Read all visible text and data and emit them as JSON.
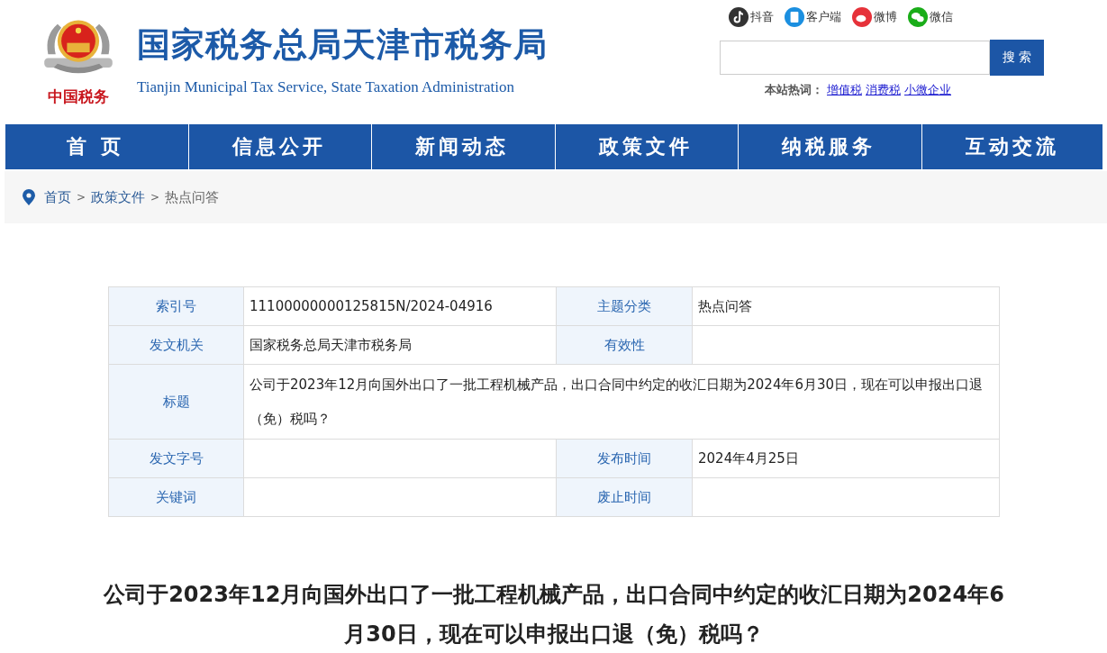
{
  "header": {
    "logo_caption": "中国税务",
    "title": "国家税务总局天津市税务局",
    "subtitle": "Tianjin Municipal Tax Service, State Taxation Administration"
  },
  "social_links": [
    {
      "kind": "tiktok",
      "label": "抖音"
    },
    {
      "kind": "app",
      "label": "客户端"
    },
    {
      "kind": "weibo",
      "label": "微博"
    },
    {
      "kind": "wechat",
      "label": "微信"
    }
  ],
  "search": {
    "button": "搜 索"
  },
  "hot_words": {
    "label": "本站热词：",
    "links": [
      "增值税",
      "消费税",
      "小微企业"
    ]
  },
  "nav": [
    {
      "label": "首 页",
      "selected": false
    },
    {
      "label": "信息公开",
      "selected": false
    },
    {
      "label": "新闻动态",
      "selected": false
    },
    {
      "label": "政策文件",
      "selected": false
    },
    {
      "label": "纳税服务",
      "selected": false
    },
    {
      "label": "互动交流",
      "selected": false
    }
  ],
  "breadcrumb": {
    "items": [
      "首页",
      "政策文件",
      "热点问答"
    ],
    "separator": ">"
  },
  "info_table": {
    "rows": [
      {
        "cells": [
          {
            "label": "索引号",
            "value": "11100000000125815N/2024-04916"
          },
          {
            "label": "主题分类",
            "value": "热点问答"
          }
        ]
      },
      {
        "cells": [
          {
            "label": "发文机关",
            "value": "国家税务总局天津市税务局"
          },
          {
            "label": "有效性"
          }
        ]
      },
      {
        "cells": [
          {
            "label": "标题",
            "value": "公司于2023年12月向国外出口了一批工程机械产品，出口合同中约定的收汇日期为2024年6月30日，现在可以申报出口退（免）税吗？"
          }
        ]
      },
      {
        "cells": [
          {
            "label": "发文字号"
          },
          {
            "label": "发布时间",
            "value": "2024年4月25日"
          }
        ]
      },
      {
        "cells": [
          {
            "label": "关键词"
          },
          {
            "label": "废止时间"
          }
        ]
      }
    ]
  },
  "article": {
    "title": "公司于2023年12月向国外出口了一批工程机械产品，出口合同中约定的收汇日期为2024年6月30日，现在可以申报出口退（免）税吗？"
  }
}
